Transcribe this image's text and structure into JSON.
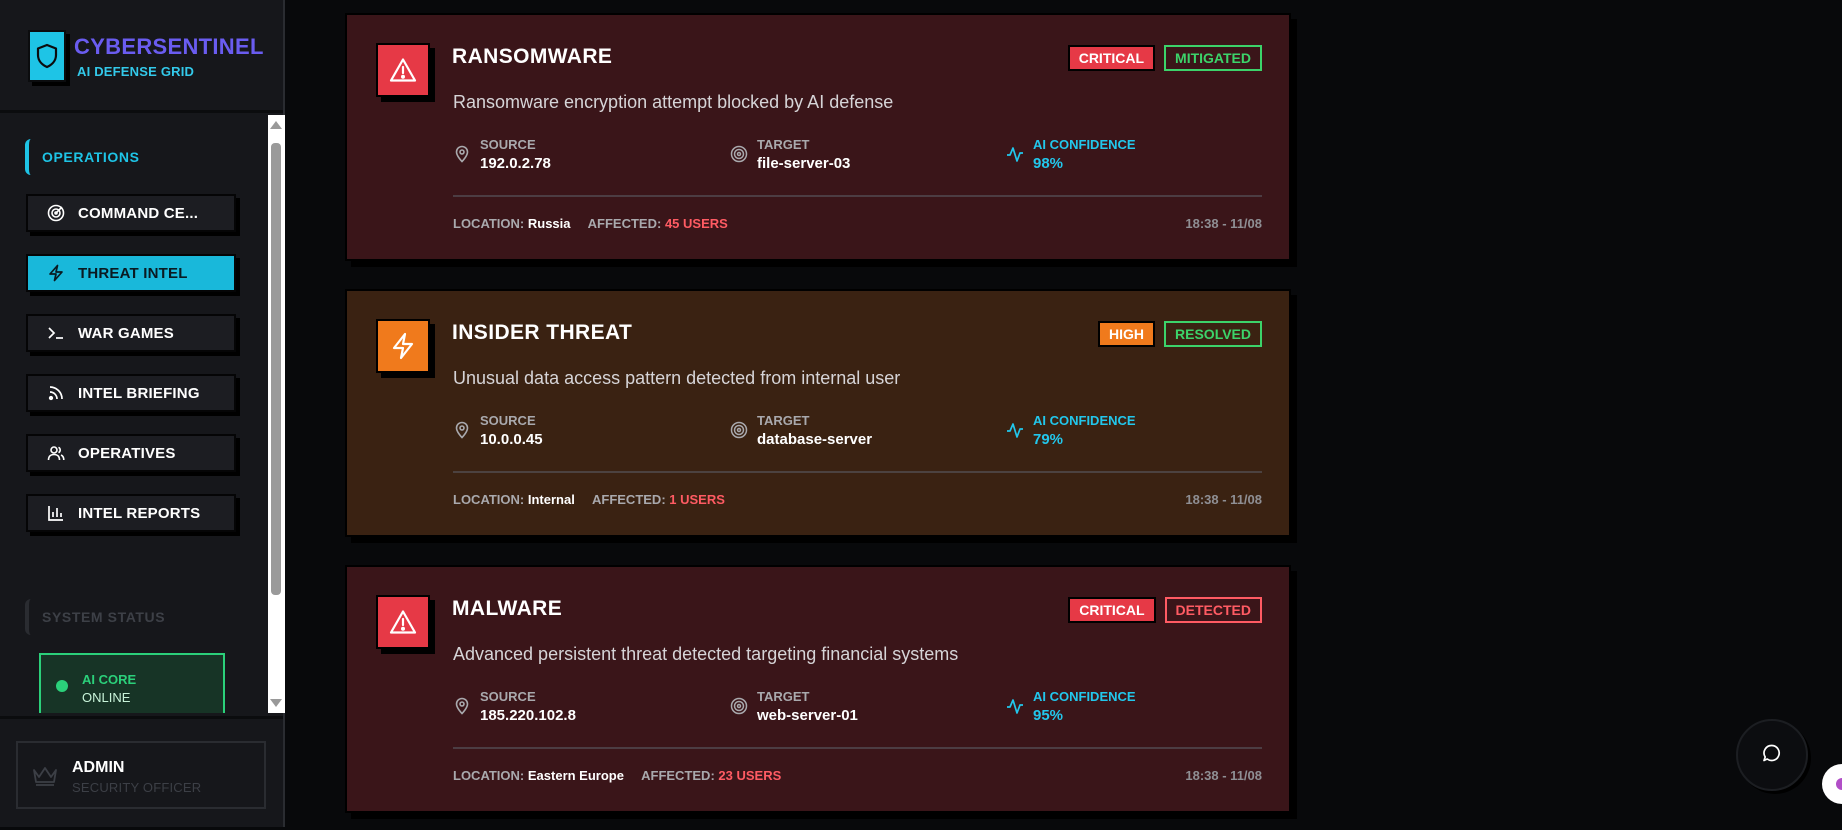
{
  "brand": {
    "name": "CYBERSENTINEL",
    "subtitle": "AI DEFENSE GRID",
    "logo_icon": "shield-icon"
  },
  "sidebar": {
    "section_operations": "OPERATIONS",
    "items": [
      {
        "label": "COMMAND CE...",
        "icon": "radar-icon",
        "active": false
      },
      {
        "label": "THREAT INTEL",
        "icon": "bolt-icon",
        "active": true
      },
      {
        "label": "WAR GAMES",
        "icon": "terminal-icon",
        "active": false
      },
      {
        "label": "INTEL BRIEFING",
        "icon": "rss-icon",
        "active": false
      },
      {
        "label": "OPERATIVES",
        "icon": "users-icon",
        "active": false
      },
      {
        "label": "INTEL REPORTS",
        "icon": "bar-chart-icon",
        "active": false
      }
    ],
    "section_status": "SYSTEM STATUS",
    "status": {
      "title": "AI CORE",
      "state": "ONLINE"
    }
  },
  "user": {
    "name": "ADMIN",
    "role": "SECURITY OFFICER",
    "icon": "crown-icon"
  },
  "labels": {
    "source": "SOURCE",
    "target": "TARGET",
    "ai_confidence": "AI CONFIDENCE",
    "location": "LOCATION:",
    "affected": "AFFECTED:"
  },
  "threats": [
    {
      "title": "RANSOMWARE",
      "severity": "CRITICAL",
      "status": "MITIGATED",
      "description": "Ransomware encryption attempt blocked by AI defense",
      "source": "192.0.2.78",
      "target": "file-server-03",
      "confidence": "98%",
      "location": "Russia",
      "affected": "45 USERS",
      "timestamp": "18:38 - 11/08"
    },
    {
      "title": "INSIDER THREAT",
      "severity": "HIGH",
      "status": "RESOLVED",
      "description": "Unusual data access pattern detected from internal user",
      "source": "10.0.0.45",
      "target": "database-server",
      "confidence": "79%",
      "location": "Internal",
      "affected": "1 USERS",
      "timestamp": "18:38 - 11/08"
    },
    {
      "title": "MALWARE",
      "severity": "CRITICAL",
      "status": "DETECTED",
      "description": "Advanced persistent threat detected targeting financial systems",
      "source": "185.220.102.8",
      "target": "web-server-01",
      "confidence": "95%",
      "location": "Eastern Europe",
      "affected": "23 USERS",
      "timestamp": "18:38 - 11/08"
    }
  ],
  "colors": {
    "accent": "#1ec4e6",
    "brand": "#6a5cf0",
    "critical": "#e63946",
    "high": "#f07a1c",
    "ok": "#3cd36a"
  },
  "chat": {
    "icon": "chat-bubble-icon"
  }
}
